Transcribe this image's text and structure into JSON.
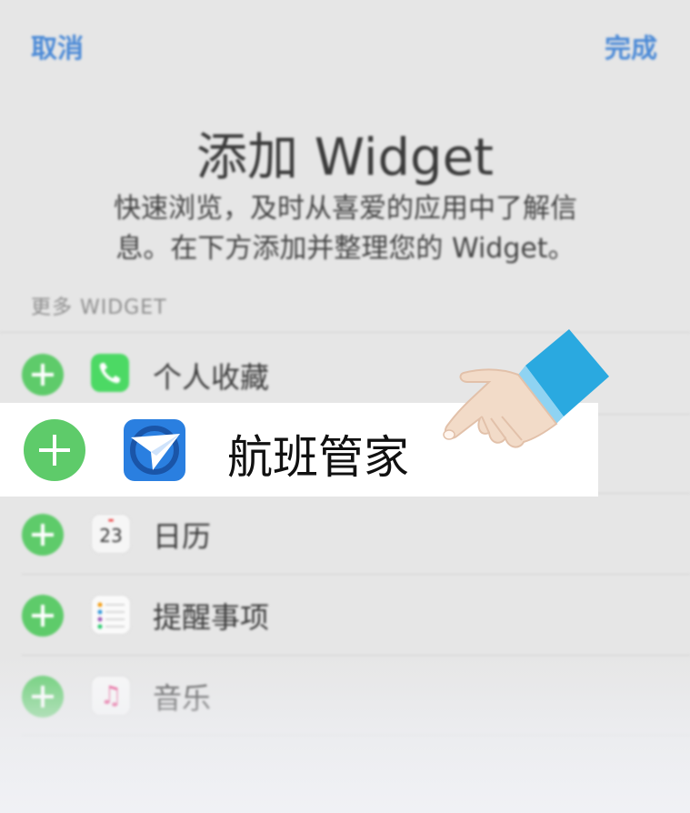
{
  "nav": {
    "cancel": "取消",
    "done": "完成"
  },
  "header": {
    "title": "添加 Widget",
    "description_line1": "快速浏览，及时从喜爱的应用中了解信",
    "description_line2": "息。在下方添加并整理您的 Widget。"
  },
  "section_label": "更多 WIDGET",
  "widgets": [
    {
      "label": "个人收藏",
      "icon": "phone-icon"
    },
    {
      "label": "航班管家",
      "icon": "paper-plane-icon"
    },
    {
      "label": "日历",
      "icon": "calendar-icon",
      "icon_text": "23"
    },
    {
      "label": "提醒事项",
      "icon": "list-icon"
    },
    {
      "label": "音乐",
      "icon": "music-note-icon",
      "icon_text": "♫"
    }
  ],
  "colors": {
    "accent": "#4a89d6",
    "add_button": "#5ecb6a",
    "app_icon_blue": "#2a7fe0",
    "phone_green": "#4cd964",
    "sleeve_blue": "#2aa9e0"
  }
}
